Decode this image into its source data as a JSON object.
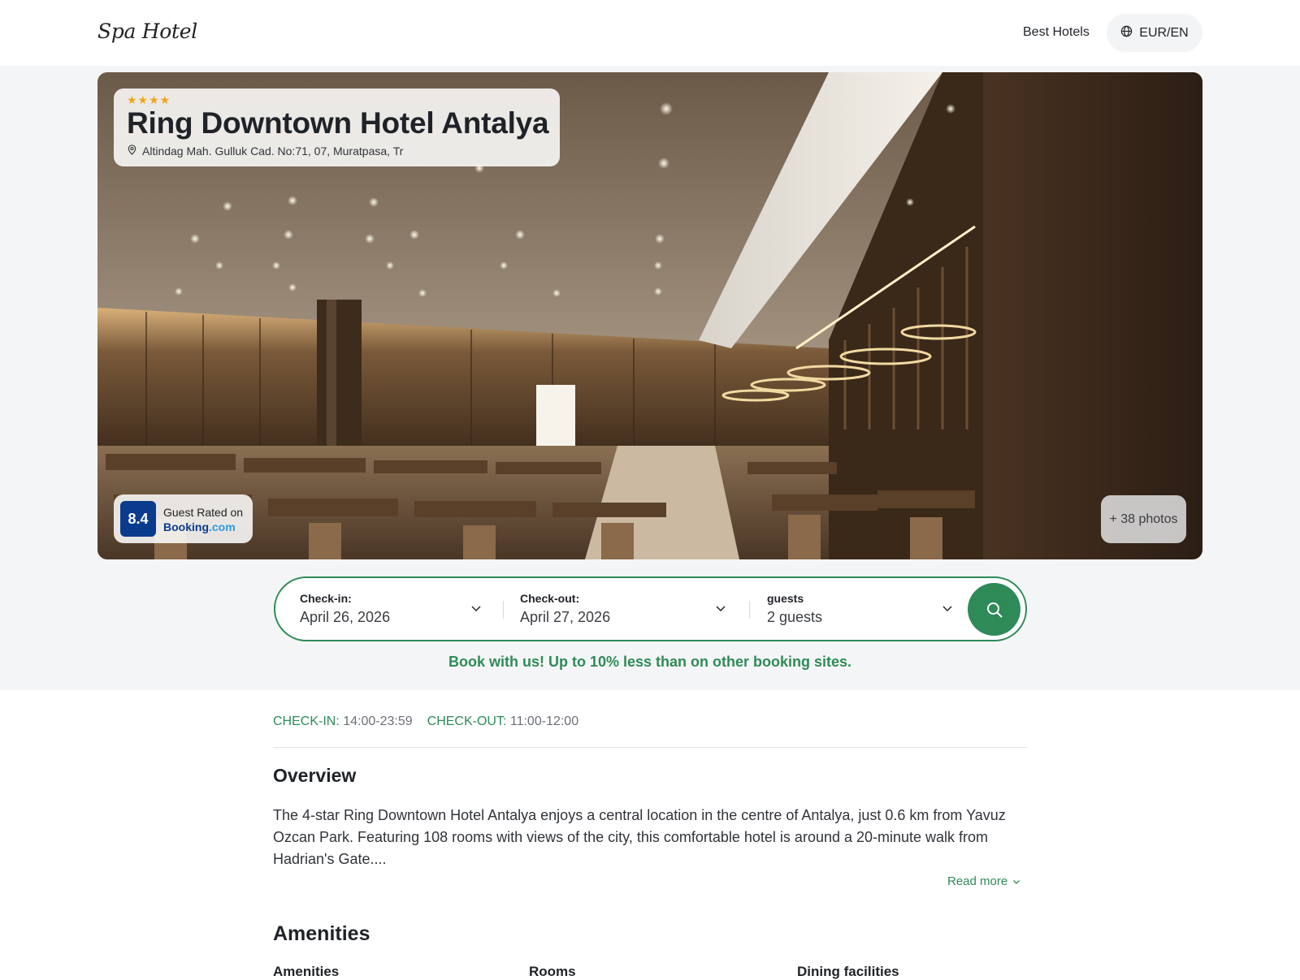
{
  "header": {
    "logo": "Spa Hotel",
    "nav_link": "Best Hotels",
    "lang_currency": "EUR/EN"
  },
  "hero": {
    "stars": "★★★★",
    "star_count": 4,
    "title": "Ring Downtown Hotel Antalya",
    "address": "Altindag Mah. Gulluk Cad. No:71, 07, Muratpasa, Tr",
    "rating": {
      "score": "8.4",
      "label": "Guest Rated on",
      "brand_main": "Booking",
      "brand_suffix": ".com"
    },
    "photos_button": "+ 38 photos"
  },
  "search": {
    "checkin": {
      "label": "Check-in:",
      "value": "April 26, 2026"
    },
    "checkout": {
      "label": "Check-out:",
      "value": "April 27, 2026"
    },
    "guests": {
      "label": "guests",
      "value": "2 guests"
    }
  },
  "promo": "Book with us! Up to 10% less than on other booking sites.",
  "times": {
    "checkin_label": "CHECK-IN:",
    "checkin_value": " 14:00-23:59",
    "checkout_label": "CHECK-OUT:",
    "checkout_value": " 11:00-12:00"
  },
  "overview": {
    "heading": "Overview",
    "text": "The 4-star Ring Downtown Hotel Antalya enjoys a central location in the centre of Antalya, just 0.6 km from Yavuz Ozcan Park. Featuring 108 rooms with views of the city, this comfortable hotel is around a 20-minute walk from Hadrian's Gate....",
    "read_more": "Read more"
  },
  "amenities": {
    "heading": "Amenities",
    "columns": [
      "Amenities",
      "Rooms",
      "Dining facilities"
    ]
  },
  "colors": {
    "accent_green": "#2e8b57",
    "star_gold": "#f2a516",
    "booking_blue": "#0b3b8c",
    "booking_light_blue": "#2d9be0"
  },
  "icons": {
    "lang": "globe-icon",
    "address": "location-pin-icon",
    "dropdown": "chevron-down-icon",
    "search": "search-icon"
  }
}
